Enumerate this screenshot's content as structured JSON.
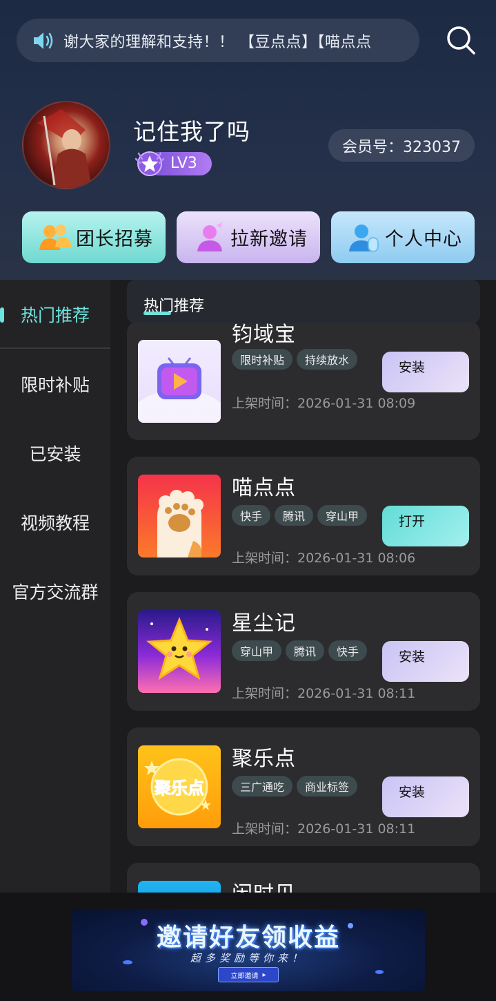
{
  "notice": {
    "icon": "speaker-icon",
    "text": "谢大家的理解和支持！！ 【豆点点】【喵点点"
  },
  "profile": {
    "username": "记住我了吗",
    "level": "LV3",
    "member_id": "会员号：323037"
  },
  "actions": [
    {
      "label": "团长招募",
      "icon": "group-icon"
    },
    {
      "label": "拉新邀请",
      "icon": "invite-icon"
    },
    {
      "label": "个人中心",
      "icon": "user-center-icon"
    }
  ],
  "sidebar": {
    "items": [
      {
        "label": "热门推荐",
        "active": true
      },
      {
        "label": "限时补贴"
      },
      {
        "label": "已安装"
      },
      {
        "label": "视频教程"
      },
      {
        "label": "官方交流群"
      }
    ]
  },
  "section": {
    "title": "热门推荐"
  },
  "apps": [
    {
      "name": "钧域宝",
      "tags": [
        "限时补贴",
        "持续放水"
      ],
      "time": "上架时间：2026-01-31 08:09",
      "action": "安装",
      "icon": "tv-play-icon"
    },
    {
      "name": "喵点点",
      "tags": [
        "快手",
        "腾讯",
        "穿山甲"
      ],
      "time": "上架时间：2026-01-31 08:06",
      "action": "打开",
      "icon": "cat-paw-icon"
    },
    {
      "name": "星尘记",
      "tags": [
        "穿山甲",
        "腾讯",
        "快手"
      ],
      "time": "上架时间：2026-01-31 08:11",
      "action": "安装",
      "icon": "star-face-icon"
    },
    {
      "name": "聚乐点",
      "tags": [
        "三广通吃",
        "商业标签"
      ],
      "time": "上架时间：2026-01-31 08:11",
      "action": "安装",
      "icon": "juledian-logo-icon"
    },
    {
      "name": "闲时贝",
      "tags": [],
      "time": "",
      "action": "",
      "icon": "app-icon"
    }
  ],
  "banner": {
    "title": "邀请好友领收益",
    "subtitle": "超多奖励等你来！",
    "button": "立即邀请"
  },
  "colors": {
    "accent": "#6fe3dd",
    "install_btn": "#c9c4f5",
    "open_btn": "#63dcd6",
    "card_bg": "#2c2c2e"
  }
}
